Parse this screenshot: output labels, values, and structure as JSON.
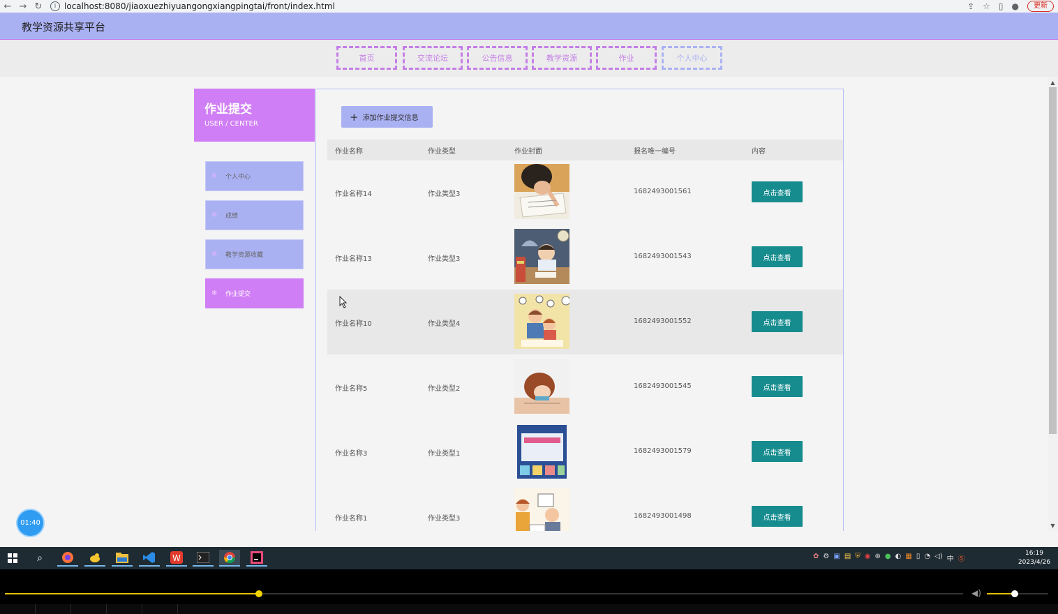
{
  "browser": {
    "url": "localhost:8080/jiaoxuezhiyuangongxiangpingtai/front/index.html",
    "update_label": "更新"
  },
  "site": {
    "title": "教学资源共享平台"
  },
  "nav": {
    "items": [
      {
        "label": "首页"
      },
      {
        "label": "交流论坛"
      },
      {
        "label": "公告信息"
      },
      {
        "label": "教学资源"
      },
      {
        "label": "作业"
      },
      {
        "label": "个人中心"
      }
    ]
  },
  "sidebar": {
    "title": "作业提交",
    "subtitle": "USER / CENTER",
    "items": [
      {
        "label": "个人中心"
      },
      {
        "label": "成绩"
      },
      {
        "label": "教学资源收藏"
      },
      {
        "label": "作业提交"
      }
    ]
  },
  "content": {
    "add_button": "添加作业提交信息",
    "columns": [
      "作业名称",
      "作业类型",
      "作业封面",
      "报名唯一编号",
      "内容"
    ],
    "view_label": "点击查看",
    "rows": [
      {
        "name": "作业名称14",
        "type": "作业类型3",
        "code": "1682493001561"
      },
      {
        "name": "作业名称13",
        "type": "作业类型3",
        "code": "1682493001543"
      },
      {
        "name": "作业名称10",
        "type": "作业类型4",
        "code": "1682493001552"
      },
      {
        "name": "作业名称5",
        "type": "作业类型2",
        "code": "1682493001545"
      },
      {
        "name": "作业名称3",
        "type": "作业类型1",
        "code": "1682493001579"
      },
      {
        "name": "作业名称1",
        "type": "作业类型3",
        "code": "1682493001498"
      }
    ]
  },
  "timer": {
    "label": "01:40"
  },
  "taskbar": {
    "clock_time": "16:19",
    "clock_date": "2023/4/26",
    "ime_label": "中"
  },
  "player": {
    "seek_fraction": 0.265,
    "volume_fraction": 0.45
  },
  "colors": {
    "header_bg": "#aab1f3",
    "accent_purple": "#d07ef5",
    "button_teal": "#168c8f"
  }
}
